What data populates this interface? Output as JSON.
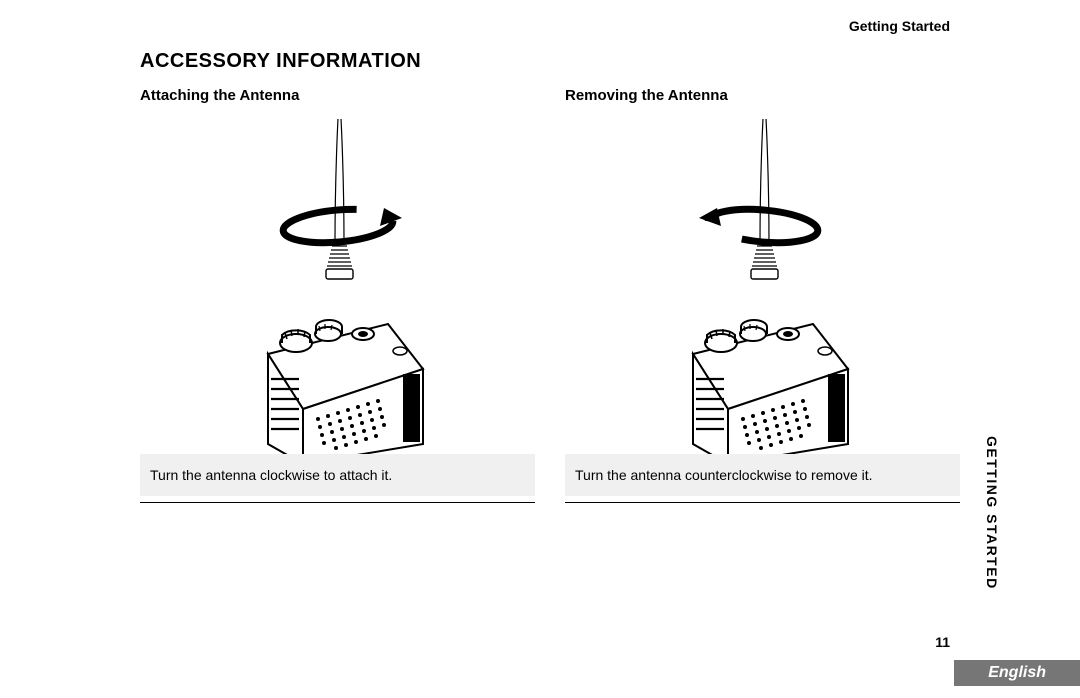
{
  "running_head": "Getting Started",
  "main_heading": "ACCESSORY INFORMATION",
  "left": {
    "sub_heading": "Attaching the Antenna",
    "caption": "Turn the antenna clockwise to attach it."
  },
  "right": {
    "sub_heading": "Removing the Antenna",
    "caption": "Turn the antenna counterclockwise to remove it."
  },
  "side_tab": "GETTING STARTED",
  "page_number": "11",
  "language": "English"
}
